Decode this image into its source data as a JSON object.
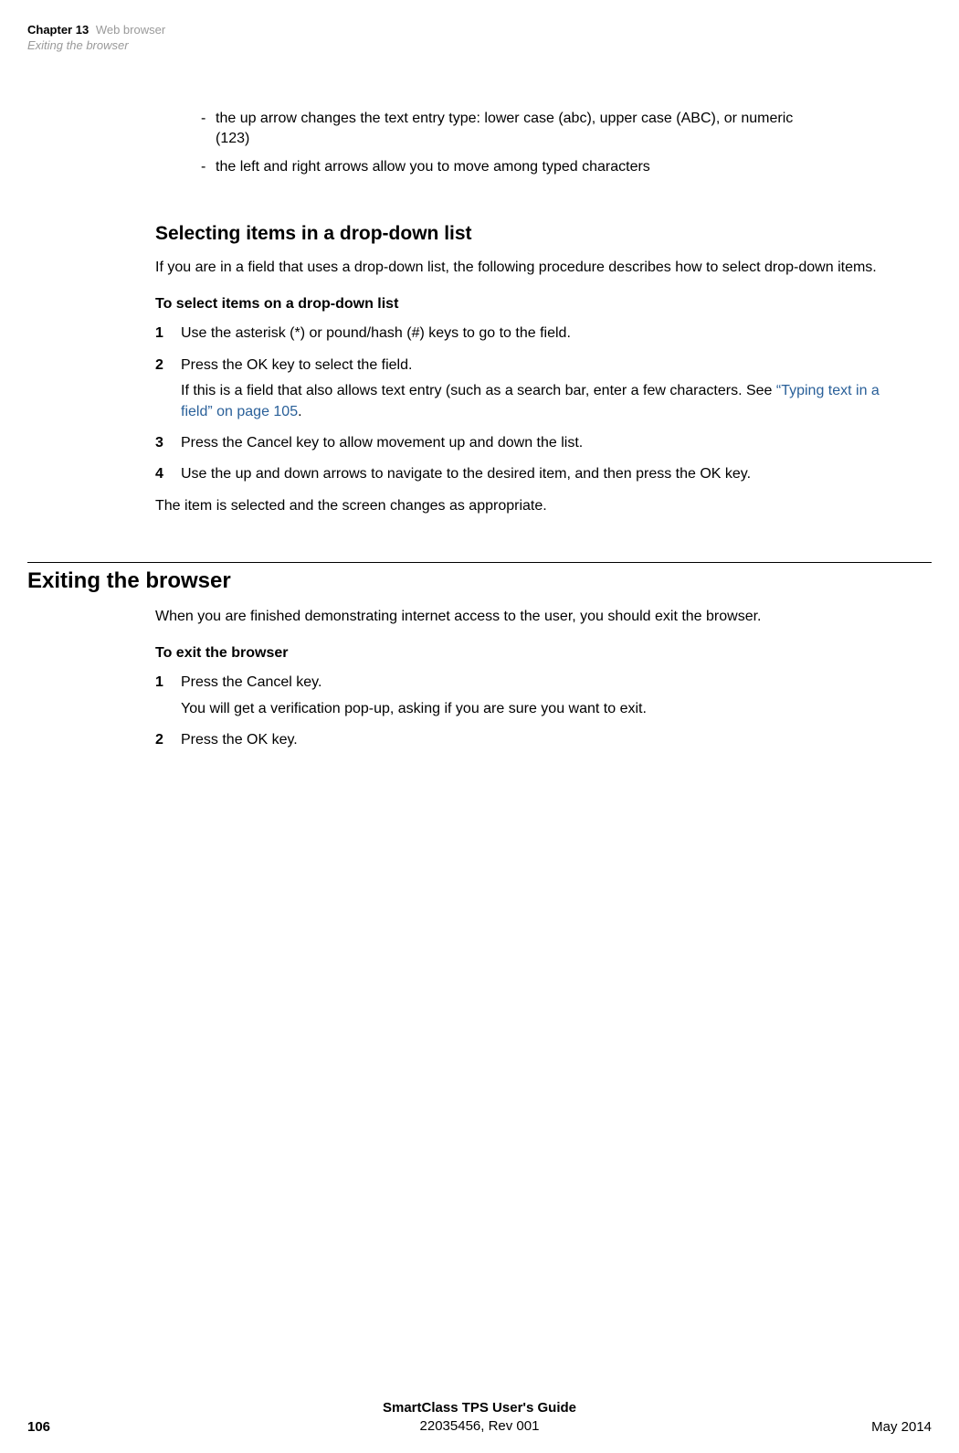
{
  "header": {
    "chapter_label": "Chapter 13",
    "chapter_name": "Web browser",
    "section": "Exiting the browser"
  },
  "bullets": {
    "b1": "the up arrow changes the text entry type: lower case (abc), upper case (ABC), or numeric (123)",
    "b2": "the left and right arrows allow you to move among typed characters"
  },
  "selecting": {
    "heading": "Selecting items in a drop-down list",
    "intro": "If you are in a field that uses a drop-down list, the following procedure describes how to select drop-down items.",
    "sub_heading": "To select items on a drop-down list",
    "steps": {
      "s1_num": "1",
      "s1_text": "Use the asterisk (*) or pound/hash (#) keys to go to the field.",
      "s2_num": "2",
      "s2_text": "Press the OK key to select the field.",
      "s2_sub_prefix": "If this is a field that also allows text entry (such as a search bar, enter a few characters. See ",
      "s2_link": "“Typing text in a field” on page 105",
      "s2_sub_suffix": ".",
      "s3_num": "3",
      "s3_text": "Press the Cancel key to allow movement up and down the list.",
      "s4_num": "4",
      "s4_text": "Use the up and down arrows to navigate to the desired item, and then press the OK key."
    },
    "outro": "The item is selected and the screen changes as appropriate."
  },
  "exiting": {
    "heading": "Exiting the browser",
    "intro": "When you are finished demonstrating internet access to the user, you should exit the browser.",
    "sub_heading": "To exit the browser",
    "steps": {
      "s1_num": "1",
      "s1_text": "Press the Cancel key.",
      "s1_sub": "You will get a verification pop-up, asking if you are sure you want to exit.",
      "s2_num": "2",
      "s2_text": "Press the OK key."
    }
  },
  "footer": {
    "guide_title": "SmartClass TPS User's Guide",
    "doc_id": "22035456, Rev 001",
    "page": "106",
    "date": "May 2014"
  }
}
